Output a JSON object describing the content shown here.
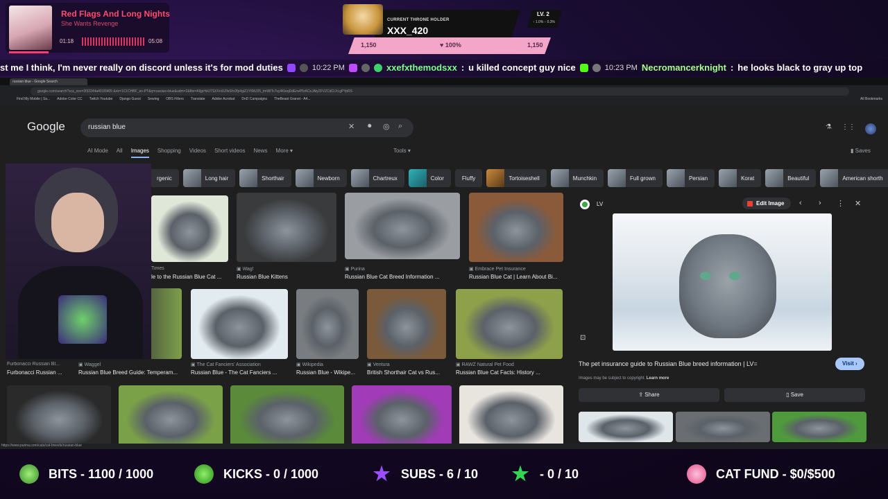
{
  "now_playing": {
    "song": "Red Flags And Long Nights",
    "artist": "She Wants Revenge",
    "elapsed": "01:18",
    "duration": "05:08",
    "progress": 0.25
  },
  "throne": {
    "caption": "CURRENT THRONE HOLDER",
    "name": "XXX_420",
    "level": "LV. 2",
    "level_sub": "↑ 1.0% ↑ 0.3%",
    "hp_left": "1,150",
    "hp_percent": "100%",
    "hp_right": "1,150"
  },
  "chat": {
    "msg1_tail": "st me I think, I'm never really on discord unless it's for mod duties",
    "time1": "10:22 PM",
    "user1": "xxefxthemodsxx",
    "msg2": "u killed concept guy nice",
    "time2": "10:23 PM",
    "user2": "Necromancerknight",
    "msg3": "he looks black to gray up top"
  },
  "browser": {
    "tab_title": "russian blue - Google Search",
    "url": "google.com/search?sca_esv=3f32244a401f3405 &rlz=1C1CHBF_en-PT&q=russian+blue&udm=2&fbs=AIIjpHxU7SXXniUZfeShr2fp4giZ1Y6MJ25_tmWITc7uy4KIeqDdErwP5rACeJAty2FVZCdCiJrLgPYpRS",
    "bookmarks": [
      "Find My Mobile | Sa...",
      "Adobe Color CC",
      "Twitch Youtube",
      "Django Guest",
      "Sewing",
      "OBS Filters",
      "Translate",
      "Adobe Acrobat",
      "DnD Campaigns",
      "TheBeast Granet - A4..."
    ],
    "bookmarks_right": "All Bookmarks"
  },
  "google": {
    "logo": "Google",
    "query": "russian blue",
    "tabs": [
      "AI Mode",
      "All",
      "Images",
      "Shopping",
      "Videos",
      "Short videos",
      "News",
      "More ▾"
    ],
    "active_tab": "Images",
    "tools": "Tools ▾",
    "saves": "Saves",
    "chips": [
      "rgenic",
      "Long hair",
      "Shorthair",
      "Newborn",
      "Chartreux",
      "Color",
      "Fluffy",
      "Tortoiseshell",
      "Munchkin",
      "Full grown",
      "Persian",
      "Korat",
      "Beautiful",
      "American shorth"
    ]
  },
  "results_row1": [
    {
      "src": "Times",
      "title": "le to the Russian Blue Cat ..."
    },
    {
      "src": "Wag!",
      "title": "Russian Blue Kittens"
    },
    {
      "src": "Purina",
      "title": "Russian Blue Cat Breed Information ..."
    },
    {
      "src": "Embrace Pet Insurance",
      "title": "Russian Blue Cat | Learn About Bi..."
    }
  ],
  "results_row2": [
    {
      "src": "Furbonacci Russian Bl...",
      "title": "Furbonacci Russian ..."
    },
    {
      "src": "Waggel",
      "title": "Russian Blue Breed Guide: Temperam..."
    },
    {
      "src": "The Cat Fanciers' Association",
      "title": "Russian Blue - The Cat Fanciers ..."
    },
    {
      "src": "Wikipedia",
      "title": "Russian Blue - Wikipe..."
    },
    {
      "src": "Ventura",
      "title": "British Shorthair Cat vs Rus..."
    },
    {
      "src": "RAWZ Natural Pet Food",
      "title": "Russian Blue Cat Facts: History ..."
    }
  ],
  "panel": {
    "site": "LV",
    "edit": "Edit Image",
    "title": "The pet insurance guide to Russian Blue breed information | LV=",
    "visit": "Visit ›",
    "copyright": "Images may be subject to copyright.",
    "learn_more": "Learn more",
    "share": "Share",
    "save": "Save"
  },
  "status_url": "https://www.purina.com/cats/cat-breeds/russian-blue",
  "goals": [
    {
      "label": "BITS - 1100 / 1000",
      "color": "#6ee04a"
    },
    {
      "label": "KICKS - 0 / 1000",
      "color": "#55e03a"
    },
    {
      "label": "SUBS - 6 / 10",
      "color": "#9b4dff"
    },
    {
      "label": "- 0 / 10",
      "color": "#33d651"
    },
    {
      "label": "CAT FUND - $0/$500",
      "color": "#ff8ac2"
    }
  ]
}
